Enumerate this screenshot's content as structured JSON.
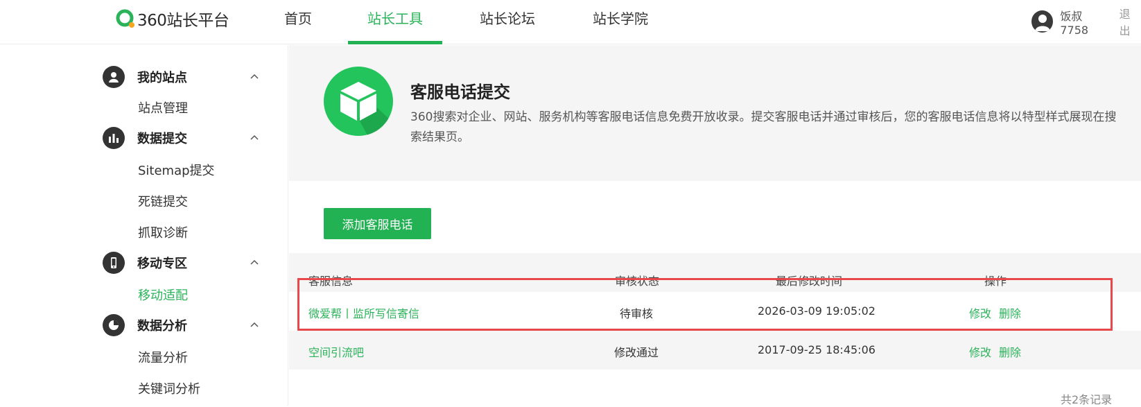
{
  "header": {
    "logo_text": "360站长平台",
    "nav": [
      "首页",
      "站长工具",
      "站长论坛",
      "站长学院"
    ],
    "active_nav": "站长工具",
    "user": {
      "name": "饭叔7758",
      "logout": "退出"
    }
  },
  "sidebar": {
    "groups": [
      {
        "title": "我的站点",
        "icon": "user-icon",
        "items": [
          "站点管理"
        ]
      },
      {
        "title": "数据提交",
        "icon": "bar-chart-icon",
        "items": [
          "Sitemap提交",
          "死链提交",
          "抓取诊断"
        ]
      },
      {
        "title": "移动专区",
        "icon": "mobile-icon",
        "items": [
          "移动适配"
        ]
      },
      {
        "title": "数据分析",
        "icon": "pie-chart-icon",
        "items": [
          "流量分析",
          "关键词分析"
        ]
      }
    ],
    "active_item": "移动适配"
  },
  "intro": {
    "title": "客服电话提交",
    "desc": "360搜索对企业、网站、服务机构等客服电话信息免费开放收录。提交客服电话并通过审核后，您的客服电话信息将以特型样式展现在搜索结果页。",
    "icon": "cube-icon"
  },
  "add_button": "添加客服电话",
  "table": {
    "columns": [
      "客服信息",
      "审核状态",
      "最后修改时间",
      "操作"
    ],
    "rows": [
      {
        "info": "微爱帮丨监所写信寄信",
        "status": "待审核",
        "time": "2026-03-09 19:05:02",
        "edit": "修改",
        "delete": "删除"
      },
      {
        "info": "空间引流吧",
        "status": "修改通过",
        "time": "2017-09-25 18:45:06",
        "edit": "修改",
        "delete": "删除"
      }
    ]
  },
  "total": "共2条记录",
  "colors": {
    "brand_green": "#22b153",
    "highlight_red": "#e8474b"
  }
}
